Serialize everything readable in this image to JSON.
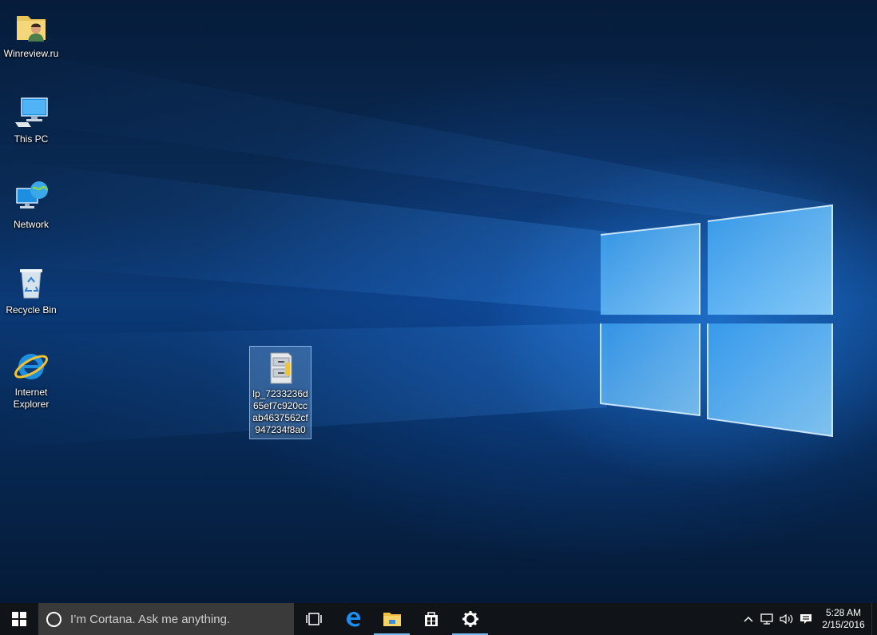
{
  "desktop": {
    "icons": [
      {
        "label": "Winreview.ru",
        "icon": "user-folder-icon"
      },
      {
        "label": "This PC",
        "icon": "computer-icon"
      },
      {
        "label": "Network",
        "icon": "network-icon"
      },
      {
        "label": "Recycle Bin",
        "icon": "recycle-bin-icon"
      },
      {
        "label_line1": "Internet",
        "label_line2": "Explorer",
        "icon": "internet-explorer-icon"
      },
      {
        "label": "lp_7233236d65ef7c920ccab4637562cf947234f8a0",
        "icon": "file-cabinet-icon",
        "selected": true
      }
    ]
  },
  "taskbar": {
    "start_icon": "windows-logo-icon",
    "search_placeholder": "I’m Cortana. Ask me anything.",
    "pinned": [
      {
        "name": "task-view-icon"
      },
      {
        "name": "edge-icon"
      },
      {
        "name": "file-explorer-icon",
        "active": true
      },
      {
        "name": "store-icon"
      },
      {
        "name": "settings-gear-icon",
        "active": true
      }
    ],
    "tray": {
      "icons": [
        "chevron-up-icon",
        "network-status-icon",
        "volume-icon",
        "action-center-icon"
      ],
      "time": "5:28 AM",
      "date": "2/15/2016"
    }
  },
  "colors": {
    "accent": "#76b9ed",
    "taskbar": "#101418",
    "search_box": "#3a3a3a"
  }
}
